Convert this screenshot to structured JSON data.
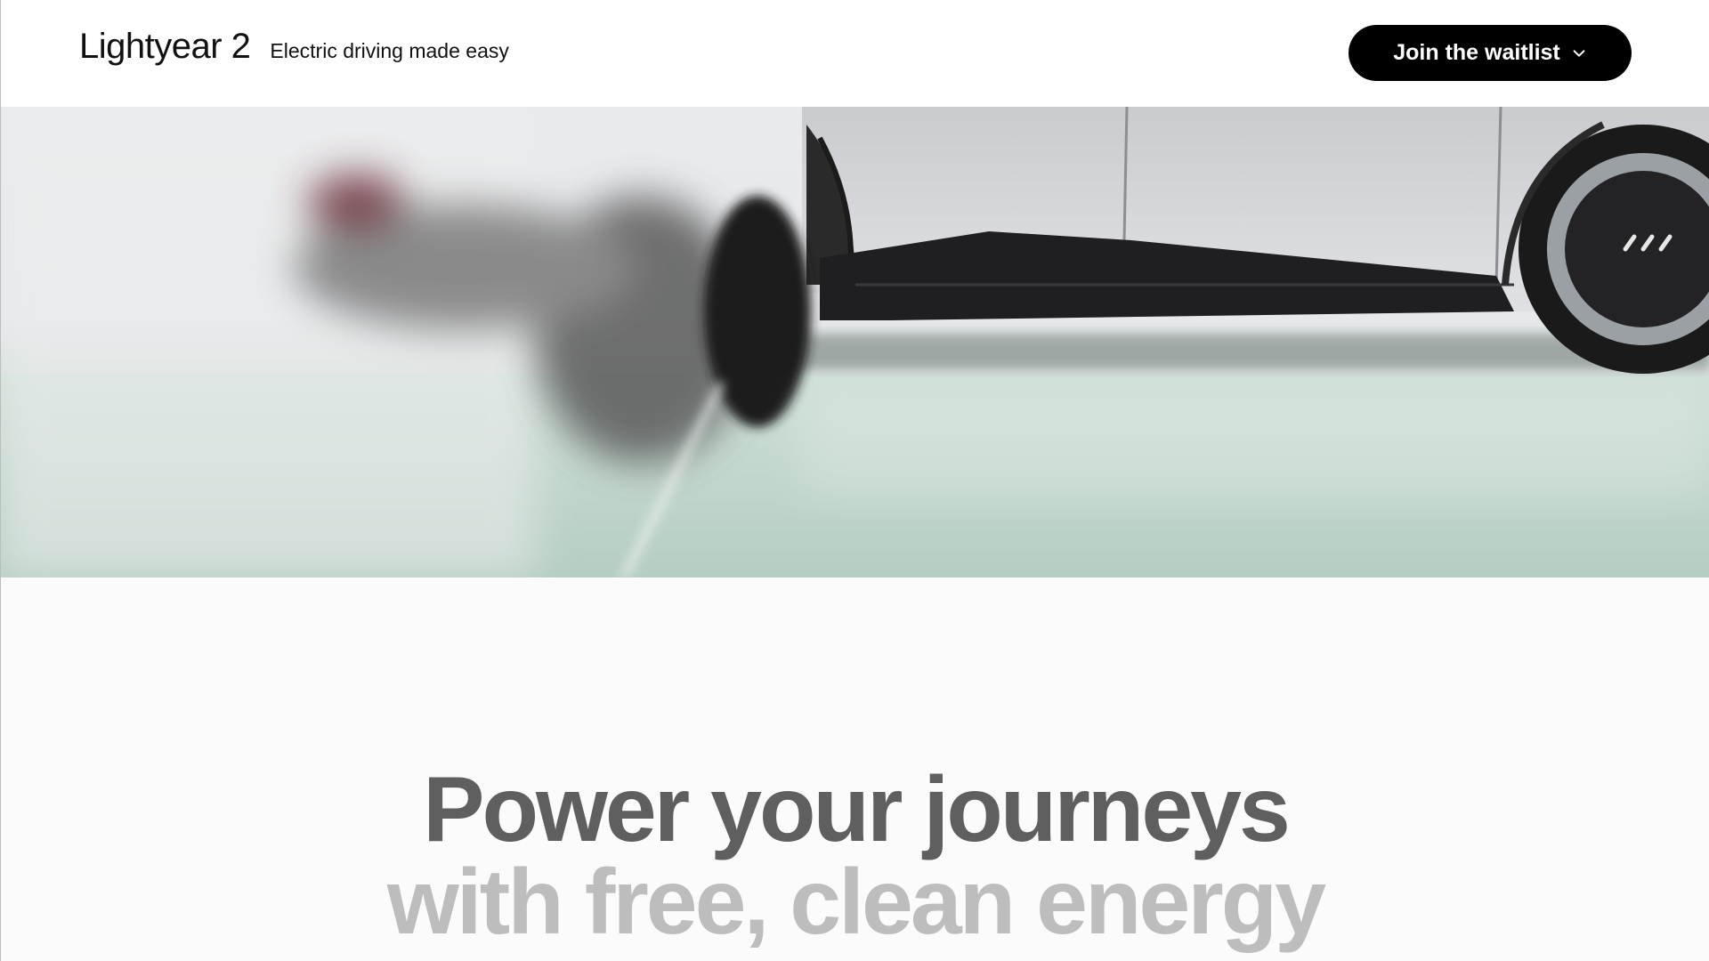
{
  "header": {
    "brand_name": "Lightyear 2",
    "tagline": "Electric driving made easy",
    "cta_label": "Join the waitlist",
    "cta_icon": "chevron-down-icon"
  },
  "hero": {
    "image_description_icon": "car-photo"
  },
  "headline": {
    "line1": "Power your journeys",
    "line2": "with free, clean energy"
  },
  "colors": {
    "button_bg": "#000000",
    "headline_primary": "#5f5f5f",
    "headline_secondary": "#bdbdbd",
    "floor_tint": "#b9d0c6"
  }
}
